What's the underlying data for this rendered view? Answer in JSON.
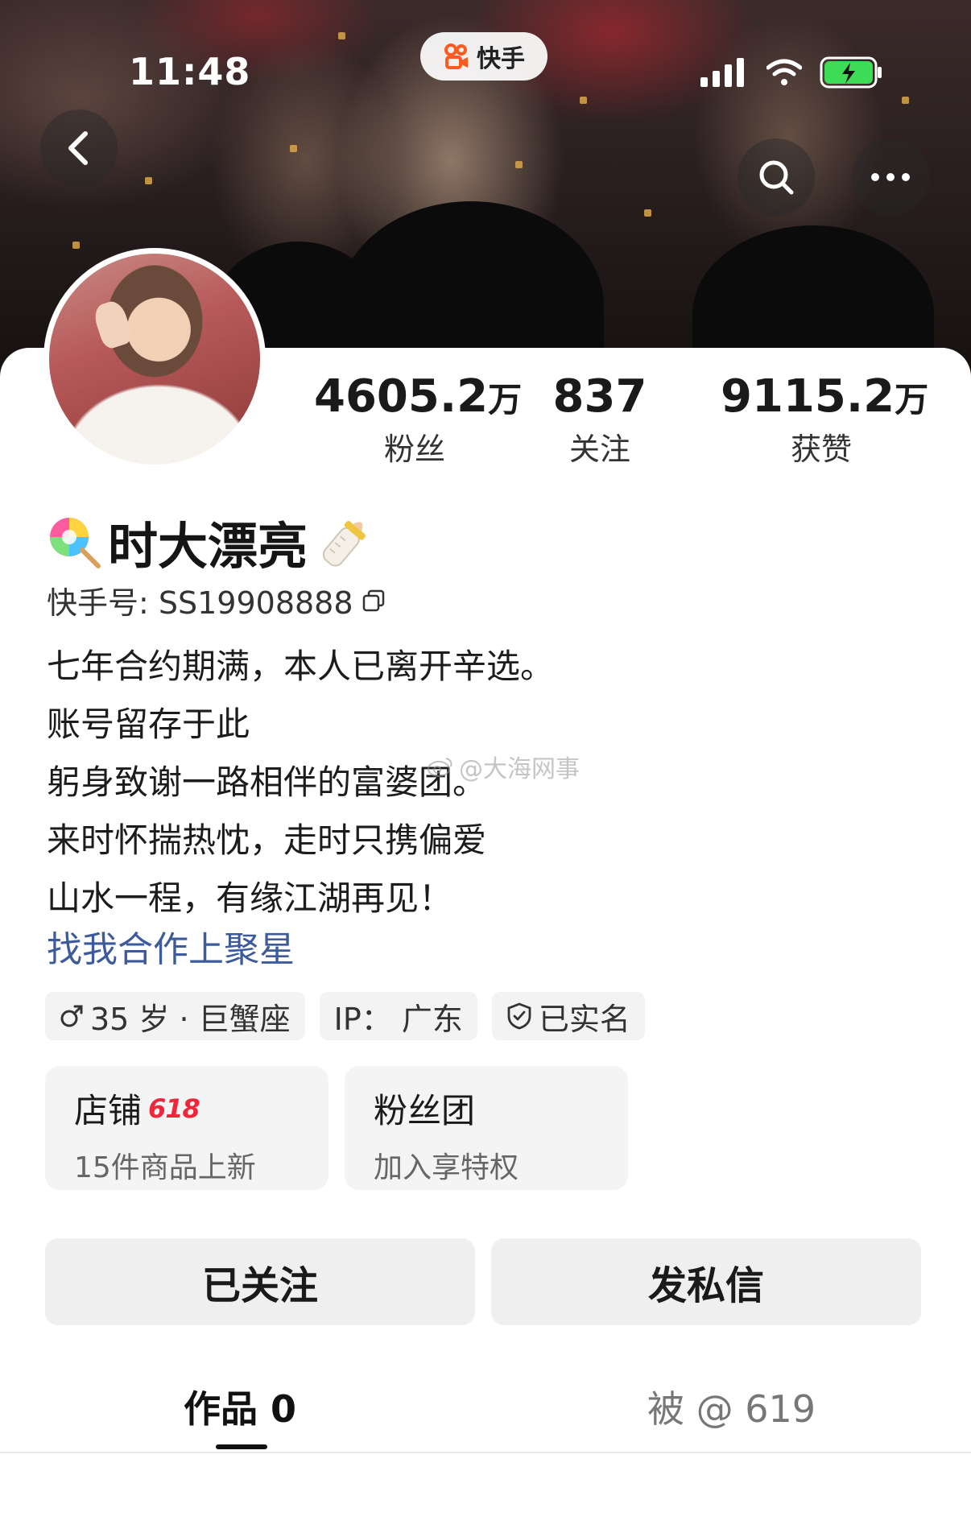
{
  "status_bar": {
    "time": "11:48",
    "app_name": "快手"
  },
  "header": {
    "back_icon": "chevron-left-icon",
    "search_icon": "search-icon",
    "more_icon": "more-icon"
  },
  "stats": [
    {
      "value": "4605.2",
      "unit": "万",
      "label": "粉丝"
    },
    {
      "value": "837",
      "unit": "",
      "label": "关注"
    },
    {
      "value": "9115.2",
      "unit": "万",
      "label": "获赞"
    }
  ],
  "profile": {
    "name": "时大漂亮",
    "kwai_id": "快手号: SS19908888",
    "bio": [
      "七年合约期满，本人已离开辛选。",
      "账号留存于此",
      "躬身致谢一路相伴的富婆团。",
      "来时怀揣热忱，走时只携偏爱",
      "山水一程，有缘江湖再见！"
    ],
    "bio_link": "找我合作上聚星"
  },
  "watermark": "@大海网事",
  "tags": [
    {
      "icon": "male-icon",
      "text": "35 岁 · 巨蟹座"
    },
    {
      "icon": "",
      "text": "IP： 广东"
    },
    {
      "icon": "verified-shield-icon",
      "text": "已实名"
    }
  ],
  "entries": [
    {
      "title": "店铺",
      "badge": "618",
      "subtitle": "15件商品上新"
    },
    {
      "title": "粉丝团",
      "badge": "",
      "subtitle": "加入享特权"
    }
  ],
  "actions": {
    "follow": "已关注",
    "message": "发私信"
  },
  "tabs": {
    "works": "作品 0",
    "mentions": "被 @ 619"
  },
  "colors": {
    "link": "#3d5a9b",
    "badge": "#f0263a",
    "chip_bg": "#f3f3f3"
  }
}
